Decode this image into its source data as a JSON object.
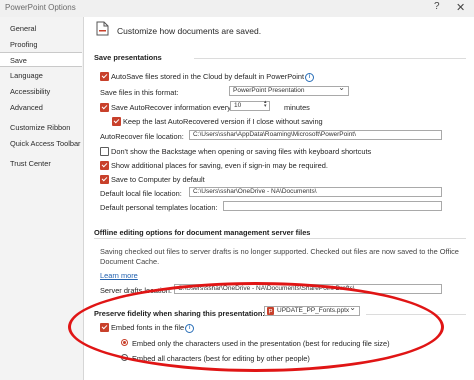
{
  "window": {
    "title": "PowerPoint Options",
    "help": "?",
    "close": "✕"
  },
  "sidebar": {
    "items": [
      {
        "label": "General"
      },
      {
        "label": "Proofing"
      },
      {
        "label": "Save",
        "selected": true
      },
      {
        "label": "Language"
      },
      {
        "label": "Accessibility"
      },
      {
        "label": "Advanced"
      },
      {
        "label": "Customize Ribbon"
      },
      {
        "label": "Quick Access Toolbar"
      },
      {
        "label": "Trust Center"
      }
    ]
  },
  "header": {
    "text": "Customize how documents are saved."
  },
  "save_presentations": {
    "title": "Save presentations",
    "autosave_label": "AutoSave files stored in the Cloud by default in PowerPoint",
    "format_label": "Save files in this format:",
    "format_value": "PowerPoint Presentation",
    "autorecover_label": "Save AutoRecover information every",
    "autorecover_minutes": "10",
    "minutes_label": "minutes",
    "keep_label": "Keep the last AutoRecovered version if I close without saving",
    "autorecover_location_label": "AutoRecover file location:",
    "autorecover_location_value": "C:\\Users\\sshar\\AppData\\Roaming\\Microsoft\\PowerPoint\\",
    "backstage_label": "Don't show the Backstage when opening or saving files with keyboard shortcuts",
    "additional_label": "Show additional places for saving, even if sign-in may be required.",
    "save_computer_label": "Save to Computer by default",
    "default_local_label": "Default local file location:",
    "default_local_value": "C:\\Users\\sshar\\OneDrive - NA\\Documents\\",
    "templates_label": "Default personal templates location:",
    "templates_value": ""
  },
  "offline": {
    "title": "Offline editing options for document management server files",
    "desc_line1": "Saving checked out files to server drafts is no longer supported. Checked out files are now saved to the Office",
    "desc_line2": "Document Cache.",
    "learn_more": "Learn more",
    "drafts_label": "Server drafts location:",
    "drafts_value": "C:\\Users\\sshar\\OneDrive - NA\\Documents\\SharePoint Drafts\\"
  },
  "fidelity": {
    "title": "Preserve fidelity when sharing this presentation:",
    "file": "UPDATE_PP_Fonts.pptx",
    "embed_label": "Embed fonts in the file",
    "only_used_label": "Embed only the characters used in the presentation (best for reducing file size)",
    "all_label": "Embed all characters (best for editing by other people)"
  },
  "colors": {
    "accent": "#c8402b",
    "highlight": "#e01515",
    "link": "#2463b0"
  },
  "icons": {
    "checkbox": "check-icon",
    "info": "info-icon",
    "doc": "document-save-icon",
    "pptx": "pptx-file-icon"
  }
}
